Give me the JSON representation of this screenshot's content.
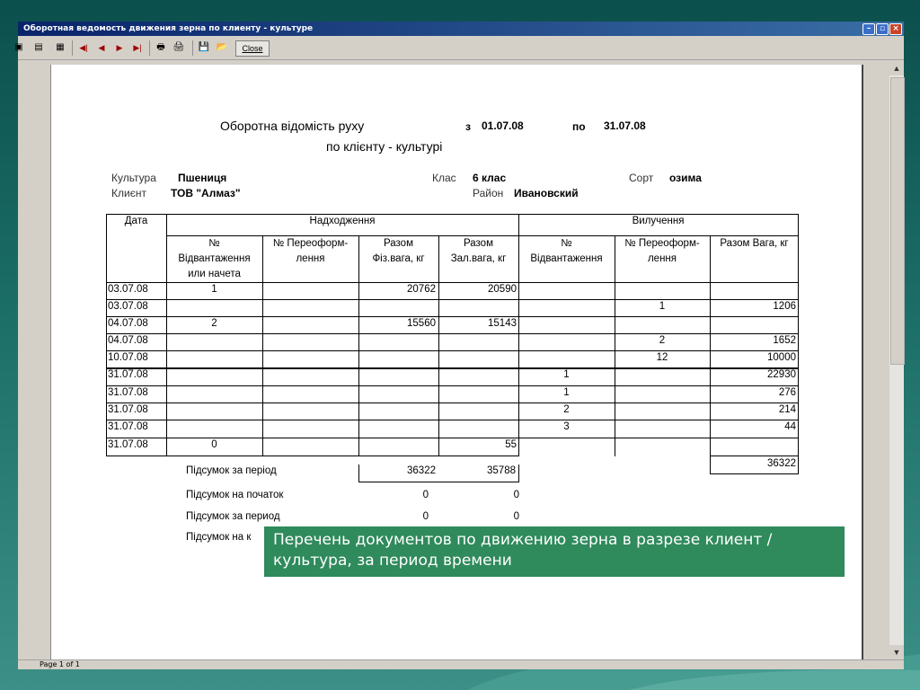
{
  "window": {
    "title": "Оборотная ведомость движения зерна по клиенту - культуре"
  },
  "toolbar": {
    "close_label": "Close"
  },
  "report": {
    "title": "Оборотна відомість руху",
    "subtitle": "по клієнту - культурі",
    "from_label": "з",
    "from_date": "01.07.08",
    "to_label": "по",
    "to_date": "31.07.08",
    "culture_label": "Культура",
    "culture_value": "Пшениця",
    "client_label": "Клиєнт",
    "client_value": "ТОВ \"Алмаз\"",
    "class_label": "Клас",
    "class_value": "6 клас",
    "district_label": "Район",
    "district_value": "Ивановский",
    "sort_label": "Сорт",
    "sort_value": "озима"
  },
  "table": {
    "group_date": "Дата",
    "group_in": "Надходження",
    "group_out": "Вилучення",
    "h_in_no_1": "№",
    "h_in_no_2": "Відвантаження",
    "h_in_no_3": "или начета",
    "h_in_ref_1": "№ Переоформ-",
    "h_in_ref_2": "лення",
    "h_in_phys_1": "Разом",
    "h_in_phys_2": "Фіз.вага, кг",
    "h_in_cred_1": "Разом",
    "h_in_cred_2": "Зал.вага, кг",
    "h_out_no_1": "№",
    "h_out_no_2": "Відвантаження",
    "h_out_ref_1": "№ Переоформ-",
    "h_out_ref_2": "лення",
    "h_out_total": "Разом Вага, кг",
    "rows": [
      {
        "date": "03.07.08",
        "in_no": "1",
        "in_ref": "",
        "in_phys": "20762",
        "in_cred": "20590",
        "out_no": "",
        "out_ref": "",
        "out_total": ""
      },
      {
        "date": "03.07.08",
        "in_no": "",
        "in_ref": "",
        "in_phys": "",
        "in_cred": "",
        "out_no": "",
        "out_ref": "1",
        "out_total": "1206"
      },
      {
        "date": "04.07.08",
        "in_no": "2",
        "in_ref": "",
        "in_phys": "15560",
        "in_cred": "15143",
        "out_no": "",
        "out_ref": "",
        "out_total": ""
      },
      {
        "date": "04.07.08",
        "in_no": "",
        "in_ref": "",
        "in_phys": "",
        "in_cred": "",
        "out_no": "",
        "out_ref": "2",
        "out_total": "1652"
      },
      {
        "date": "10.07.08",
        "in_no": "",
        "in_ref": "",
        "in_phys": "",
        "in_cred": "",
        "out_no": "",
        "out_ref": "12",
        "out_total": "10000"
      },
      {
        "date": "31.07.08",
        "in_no": "",
        "in_ref": "",
        "in_phys": "",
        "in_cred": "",
        "out_no": "1",
        "out_ref": "",
        "out_total": "22930"
      },
      {
        "date": "31.07.08",
        "in_no": "",
        "in_ref": "",
        "in_phys": "",
        "in_cred": "",
        "out_no": "1",
        "out_ref": "",
        "out_total": "276"
      },
      {
        "date": "31.07.08",
        "in_no": "",
        "in_ref": "",
        "in_phys": "",
        "in_cred": "",
        "out_no": "2",
        "out_ref": "",
        "out_total": "214"
      },
      {
        "date": "31.07.08",
        "in_no": "",
        "in_ref": "",
        "in_phys": "",
        "in_cred": "",
        "out_no": "3",
        "out_ref": "",
        "out_total": "44"
      },
      {
        "date": "31.07.08",
        "in_no": "0",
        "in_ref": "",
        "in_phys": "",
        "in_cred": "55",
        "out_no": "",
        "out_ref": "",
        "out_total": ""
      }
    ]
  },
  "totals": {
    "period_label": "Підсумок за період",
    "period_phys": "36322",
    "period_cred": "35788",
    "out_total": "36322",
    "start_label": "Підсумок на початок",
    "start_phys": "0",
    "start_cred": "0",
    "period2_label": "Підсумок за период",
    "period2_phys": "0",
    "period2_cred": "0",
    "end_label_visible": "Підсумок на к"
  },
  "overlay_note": "Перечень документов по движению зерна в разрезе клиент / культура, за период времени",
  "status": {
    "page": "Page 1 of 1"
  }
}
